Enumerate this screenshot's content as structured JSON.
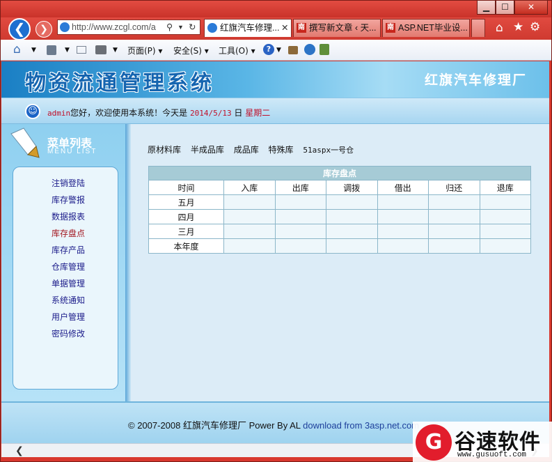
{
  "browser": {
    "address_url": "http://www.zcgl.com/a",
    "tabs": [
      {
        "label": "红旗汽车修理...",
        "active": true
      },
      {
        "label": "撰写新文章 ‹ 天...",
        "active": false,
        "icon_text": "南"
      },
      {
        "label": "ASP.NET毕业设...",
        "active": false,
        "icon_text": "南"
      }
    ],
    "close_tab_glyph": "✕",
    "commands": {
      "page": "页面(P)",
      "safety": "安全(S)",
      "tools": "工具(O)"
    },
    "colors": {
      "chrome": "#d8382e"
    }
  },
  "header": {
    "system_title": "物资流通管理系统",
    "company": "红旗汽车修理厂"
  },
  "welcome": {
    "user": "admin",
    "greeting": "您好，欢迎使用本系统！今天是",
    "date": "2014/5/13",
    "day_label": "日",
    "weekday": "星期二"
  },
  "menu": {
    "title": "菜单列表",
    "subtitle": "MENU LIST",
    "items": [
      {
        "label": "注销登陆"
      },
      {
        "label": "库存警报"
      },
      {
        "label": "数据报表"
      },
      {
        "label": "库存盘点",
        "active": true
      },
      {
        "label": "库存产品"
      },
      {
        "label": "仓库管理"
      },
      {
        "label": "单据管理"
      },
      {
        "label": "系统通知"
      },
      {
        "label": "用户管理"
      },
      {
        "label": "密码修改"
      }
    ]
  },
  "subnav": [
    "原材料库",
    "半成品库",
    "成品库",
    "特殊库",
    "51aspx一号仓"
  ],
  "table": {
    "caption": "库存盘点",
    "headers": [
      "时间",
      "入库",
      "出库",
      "调拨",
      "借出",
      "归还",
      "退库"
    ],
    "rows": [
      {
        "period": "五月"
      },
      {
        "period": "四月"
      },
      {
        "period": "三月"
      },
      {
        "period": "本年度"
      }
    ]
  },
  "footer": {
    "copyright": "© 2007-2008 红旗汽车修理厂 Power By AL",
    "link": "download from 3asp.net.com"
  },
  "watermark": {
    "logo_char": "G",
    "name": "谷速软件",
    "url": "www.gusuoft.com"
  }
}
